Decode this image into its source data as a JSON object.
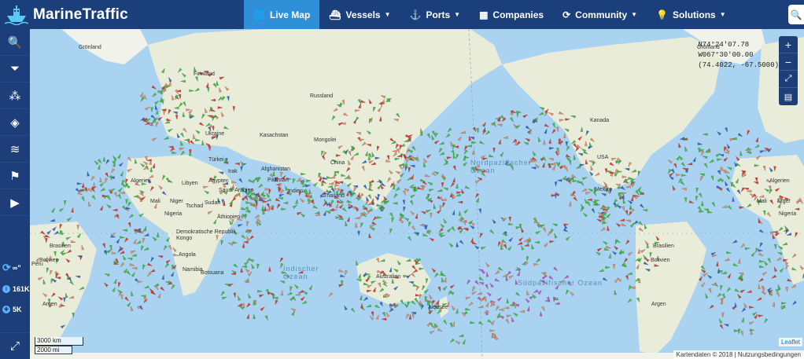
{
  "app": {
    "title": "MarineTraffic"
  },
  "nav": {
    "live_map": "Live Map",
    "vessels": "Vessels",
    "ports": "Ports",
    "companies": "Companies",
    "community": "Community",
    "solutions": "Solutions"
  },
  "sidebar": {
    "icons": [
      "search-icon",
      "filter-icon",
      "layers-share-icon",
      "map-layers-icon",
      "wind-icon",
      "route-icon",
      "play-icon"
    ],
    "refresh_value": "∞\"",
    "stat_vessels": "161K",
    "stat_ports": "5K"
  },
  "map": {
    "coord_line1": "N74°24'07.78",
    "coord_line2": "W067°30'00.00",
    "coord_line3": "(74.4022, -67.5000)",
    "scale_km": "3000 km",
    "scale_mi": "2000 mi",
    "attribution": "Kartendaten © 2018 | Nutzungsbedingungen",
    "leaflet": "Leaflet",
    "colors": {
      "ocean": "#a9d3f0",
      "land": "#e8ecd9",
      "cargo": "#3ec63e",
      "tanker": "#e53b2f",
      "passenger": "#2e6bd6",
      "fishing": "#e8906a",
      "other": "#d14fd8"
    },
    "labels": [
      "Grönland",
      "Finnland",
      "Russland",
      "Ukraine",
      "Türkei",
      "Kasachstan",
      "Mongolei",
      "China",
      "Afghanistan",
      "Pakistan",
      "Irak",
      "Saudi-Arabien",
      "Indien",
      "Thailand",
      "Algerien",
      "Libyen",
      "Ägypten",
      "Mali",
      "Niger",
      "Tschad",
      "Sudan",
      "Nigeria",
      "Äthiopien",
      "Demokratische Republik Kongo",
      "Angola",
      "Namibia",
      "Botsuana",
      "Brasilien",
      "Bolivien",
      "Argen",
      "Peru",
      "Australien",
      "Kanada",
      "USA",
      "Mexiko",
      "Neusee",
      "Grönland",
      "Algerien",
      "Nigeria",
      "Brasilien",
      "Argen",
      "Mali",
      "Niger",
      "Bolivien"
    ],
    "oceans": [
      "Nordpazifischer Ozean",
      "Südpazifischer Ozean",
      "Indischer Ozean"
    ]
  }
}
